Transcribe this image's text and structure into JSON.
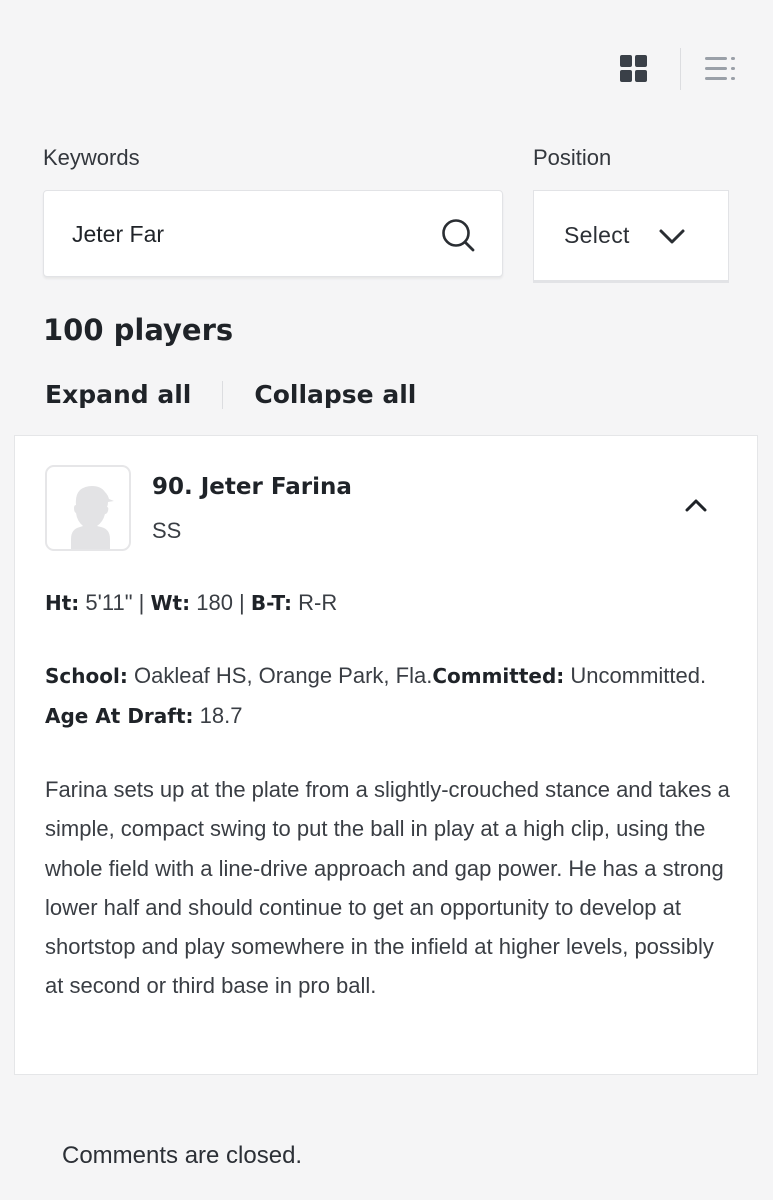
{
  "view_toggles": {
    "grid_icon": "grid-view-icon",
    "list_icon": "list-view-icon",
    "colors": {
      "grid": "#3a4048",
      "list": "#9aa0a8"
    }
  },
  "filters": {
    "keywords_label": "Keywords",
    "keywords_value": "Jeter Far",
    "search_icon": "search-icon",
    "position_label": "Position",
    "position_value": "Select",
    "position_icon": "chevron-down-icon"
  },
  "results": {
    "count_text": "100 players",
    "expand_all": "Expand all",
    "collapse_all": "Collapse all"
  },
  "player": {
    "name": "90. Jeter Farina",
    "position": "SS",
    "avatar_icon": "player-silhouette-icon",
    "ht_label": "Ht:",
    "ht_value": "5'11\"",
    "wt_label": "Wt:",
    "wt_value": "180",
    "bt_label": "B-T:",
    "bt_value": "R-R",
    "school_label": "School:",
    "school_value": "Oakleaf HS, Orange Park, Fla.",
    "committed_label": "Committed:",
    "committed_value": "Uncommitted.",
    "age_label": "Age At Draft:",
    "age_value": "18.7",
    "description": "Farina sets up at the plate from a slightly-crouched stance and takes a simple, compact swing to put the ball in play at a high clip, using the whole field with a line-drive approach and gap power. He has a strong lower half and should continue to get an opportunity to develop at shortstop and play somewhere in the infield at higher levels, possibly at second or third base in pro ball."
  },
  "footer": {
    "comments_text": "Comments are closed."
  }
}
